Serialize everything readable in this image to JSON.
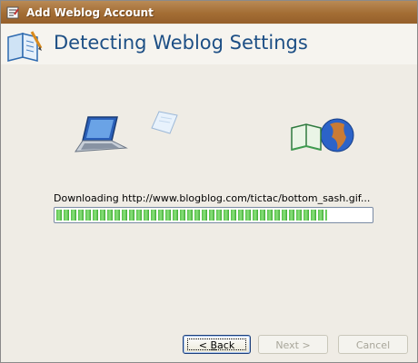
{
  "window": {
    "title": "Add Weblog Account"
  },
  "header": {
    "title": "Detecting Weblog Settings"
  },
  "icons": {
    "app": "weblog-app-icon",
    "header": "weblog-wizard-icon",
    "source": "laptop-icon",
    "transfer": "flying-page-icon",
    "destination": "globe-book-icon"
  },
  "status": {
    "text": "Downloading http://www.blogblog.com/tictac/bottom_sash.gif..."
  },
  "progress": {
    "percent": 86,
    "color": "#4cbb3c"
  },
  "buttons": {
    "back_prefix": "< ",
    "back_accel": "B",
    "back_rest": "ack",
    "next": "Next >",
    "cancel": "Cancel"
  }
}
